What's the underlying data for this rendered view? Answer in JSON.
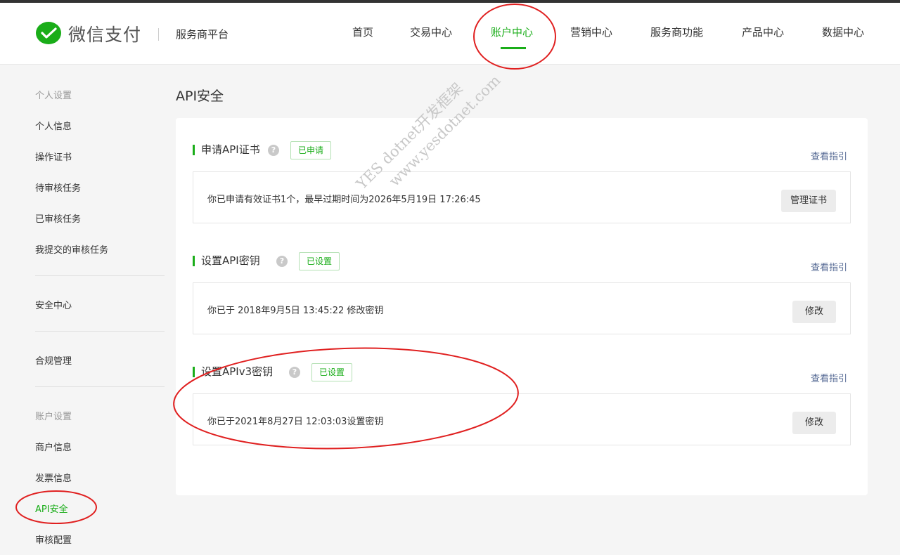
{
  "brand": {
    "logo_text": "微信支付",
    "platform": "服务商平台",
    "accent": "#1aad19"
  },
  "nav": [
    {
      "label": "首页"
    },
    {
      "label": "交易中心"
    },
    {
      "label": "账户中心",
      "active": true
    },
    {
      "label": "营销中心"
    },
    {
      "label": "服务商功能"
    },
    {
      "label": "产品中心"
    },
    {
      "label": "数据中心"
    }
  ],
  "sidebar": {
    "personal_header": "个人设置",
    "personal_items": [
      "个人信息",
      "操作证书",
      "待审核任务",
      "已审核任务",
      "我提交的审核任务"
    ],
    "security_center": "安全中心",
    "compliance": "合规管理",
    "account_header": "账户设置",
    "account_items": [
      "商户信息",
      "发票信息",
      "API安全",
      "审核配置"
    ],
    "active_item": "API安全"
  },
  "page": {
    "title": "API安全"
  },
  "sections": [
    {
      "title": "申请API证书",
      "badge": "已申请",
      "guide": "查看指引",
      "info": "你已申请有效证书1个，最早过期时间为2026年5月19日 17:26:45",
      "button": "管理证书"
    },
    {
      "title": "设置API密钥",
      "badge": "已设置",
      "guide": "查看指引",
      "info": "你已于 2018年9月5日 13:45:22 修改密钥",
      "button": "修改"
    },
    {
      "title": "设置APIv3密钥",
      "badge": "已设置",
      "guide": "查看指引",
      "info": "你已于2021年8月27日 12:03:03设置密钥",
      "button": "修改"
    }
  ],
  "help_glyph": "?",
  "watermark": {
    "line1": "YES dotnet开发框架",
    "line2": "www.yesdotnet.com"
  },
  "annotation_color": "#e02020"
}
